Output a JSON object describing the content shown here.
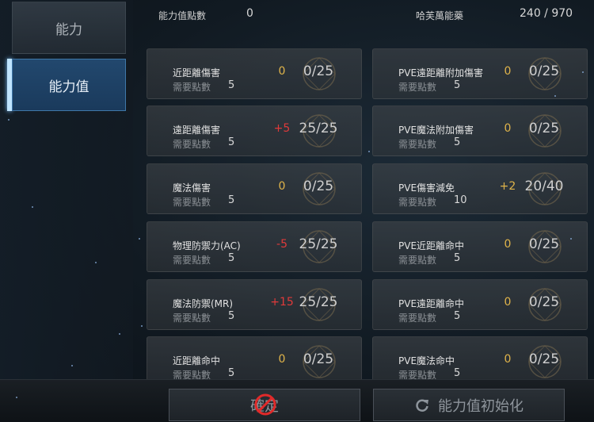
{
  "sidebar": {
    "tabs": [
      {
        "label": "能力"
      },
      {
        "label": "能力值"
      }
    ]
  },
  "header": {
    "points_label": "能力值點數",
    "points_value": "0",
    "harvest_label": "哈芙萬能藥",
    "harvest_value": "240 / 970"
  },
  "need_label": "需要點數",
  "stats": [
    {
      "name": "近距離傷害",
      "delta": "0",
      "delta_type": "zero",
      "level": "0/25",
      "need": "5"
    },
    {
      "name": "PVE遠距離附加傷害",
      "delta": "0",
      "delta_type": "zero",
      "level": "0/25",
      "need": "5"
    },
    {
      "name": "遠距離傷害",
      "delta": "+5",
      "delta_type": "pos",
      "level": "25/25",
      "need": "5"
    },
    {
      "name": "PVE魔法附加傷害",
      "delta": "0",
      "delta_type": "zero",
      "level": "0/25",
      "need": "5"
    },
    {
      "name": "魔法傷害",
      "delta": "0",
      "delta_type": "zero",
      "level": "0/25",
      "need": "5"
    },
    {
      "name": "PVE傷害減免",
      "delta": "+2",
      "delta_type": "posgold",
      "level": "20/40",
      "need": "10"
    },
    {
      "name": "物理防禦力(AC)",
      "delta": "-5",
      "delta_type": "neg",
      "level": "25/25",
      "need": "5"
    },
    {
      "name": "PVE近距離命中",
      "delta": "0",
      "delta_type": "zero",
      "level": "0/25",
      "need": "5"
    },
    {
      "name": "魔法防禦(MR)",
      "delta": "+15",
      "delta_type": "pos",
      "level": "25/25",
      "need": "5"
    },
    {
      "name": "PVE遠距離命中",
      "delta": "0",
      "delta_type": "zero",
      "level": "0/25",
      "need": "5"
    },
    {
      "name": "近距離命中",
      "delta": "0",
      "delta_type": "zero",
      "level": "0/25",
      "need": "5"
    },
    {
      "name": "PVE魔法命中",
      "delta": "0",
      "delta_type": "zero",
      "level": "0/25",
      "need": "5"
    }
  ],
  "buttons": {
    "confirm_label": "確定",
    "reset_label": "能力值初始化"
  },
  "icons": {
    "confirm_disabled": "no-entry-icon",
    "reset": "refresh-icon"
  }
}
